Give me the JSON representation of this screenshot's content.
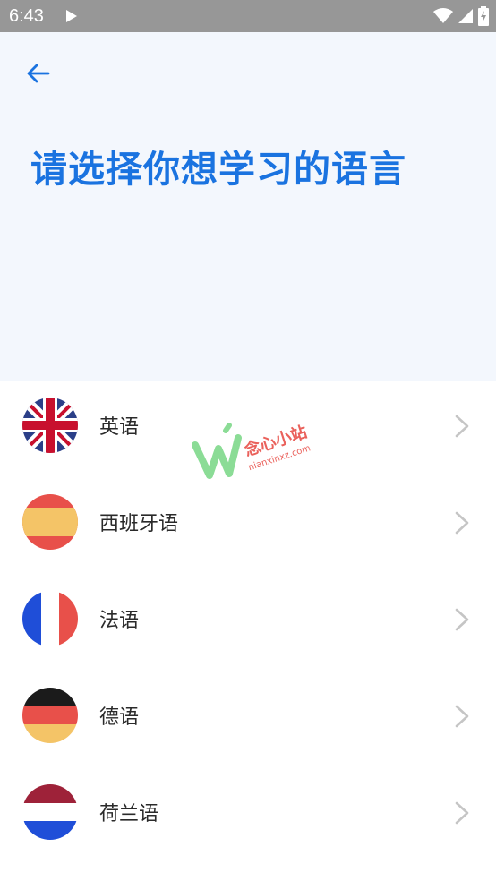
{
  "status_bar": {
    "time": "6:43"
  },
  "header": {
    "title": "请选择你想学习的语言"
  },
  "languages": [
    {
      "label": "英语",
      "flag": "uk"
    },
    {
      "label": "西班牙语",
      "flag": "spain"
    },
    {
      "label": "法语",
      "flag": "france"
    },
    {
      "label": "德语",
      "flag": "germany"
    },
    {
      "label": "荷兰语",
      "flag": "netherlands"
    }
  ],
  "watermark": {
    "name": "念心小站",
    "domain": "nianxinxz.com"
  },
  "colors": {
    "accent": "#1a73e0",
    "header_bg": "#f3f7fd",
    "status_bar": "#979797",
    "chevron": "#c5c5c5"
  }
}
